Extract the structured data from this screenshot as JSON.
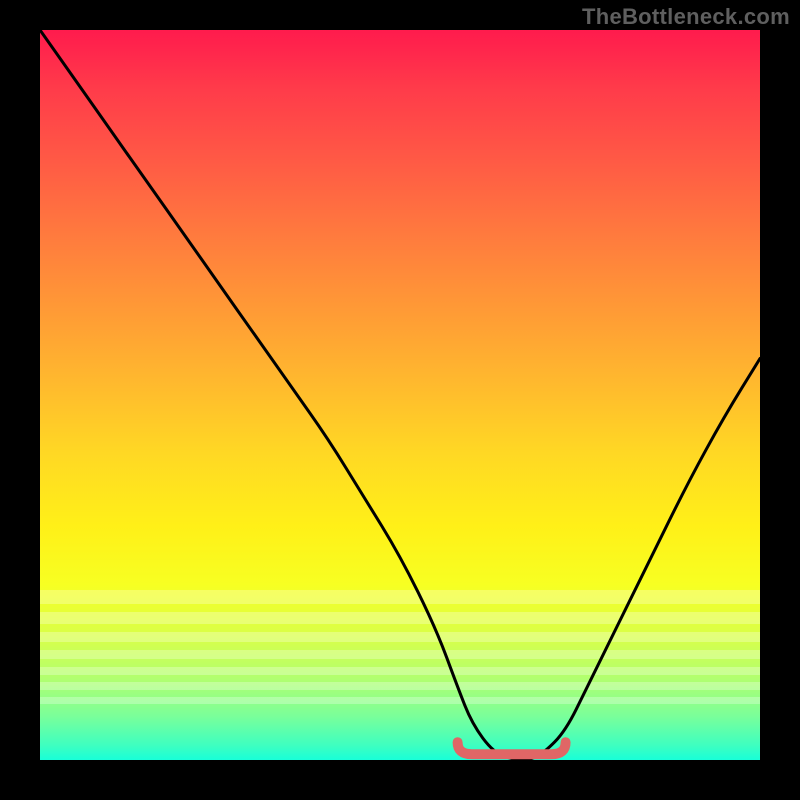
{
  "watermark": "TheBottleneck.com",
  "colors": {
    "background": "#000000",
    "curve": "#000000",
    "marker": "#e06666",
    "watermark": "#5f5f5f"
  },
  "chart_data": {
    "type": "line",
    "title": "",
    "xlabel": "",
    "ylabel": "",
    "xlim": [
      0,
      100
    ],
    "ylim": [
      0,
      100
    ],
    "grid": false,
    "series": [
      {
        "name": "bottleneck-curve",
        "x": [
          0,
          5,
          10,
          15,
          20,
          25,
          30,
          35,
          40,
          45,
          50,
          55,
          58,
          60,
          63,
          66,
          68,
          70,
          73,
          76,
          80,
          85,
          90,
          95,
          100
        ],
        "values": [
          100,
          93,
          86,
          79,
          72,
          65,
          58,
          51,
          44,
          36,
          28,
          18,
          10,
          5,
          1,
          0,
          0,
          1,
          4,
          10,
          18,
          28,
          38,
          47,
          55
        ]
      }
    ],
    "annotations": [
      {
        "name": "optimal-range-marker",
        "x_start": 58,
        "x_end": 73,
        "y": 0.8,
        "color": "#e06666"
      }
    ],
    "background_gradient_stops": [
      {
        "pos": 0,
        "color": "#ff1b4d"
      },
      {
        "pos": 18,
        "color": "#ff5a45"
      },
      {
        "pos": 38,
        "color": "#ff9936"
      },
      {
        "pos": 58,
        "color": "#ffd824"
      },
      {
        "pos": 76,
        "color": "#f7ff22"
      },
      {
        "pos": 89,
        "color": "#b0ff70"
      },
      {
        "pos": 100,
        "color": "#18ffd8"
      }
    ]
  }
}
